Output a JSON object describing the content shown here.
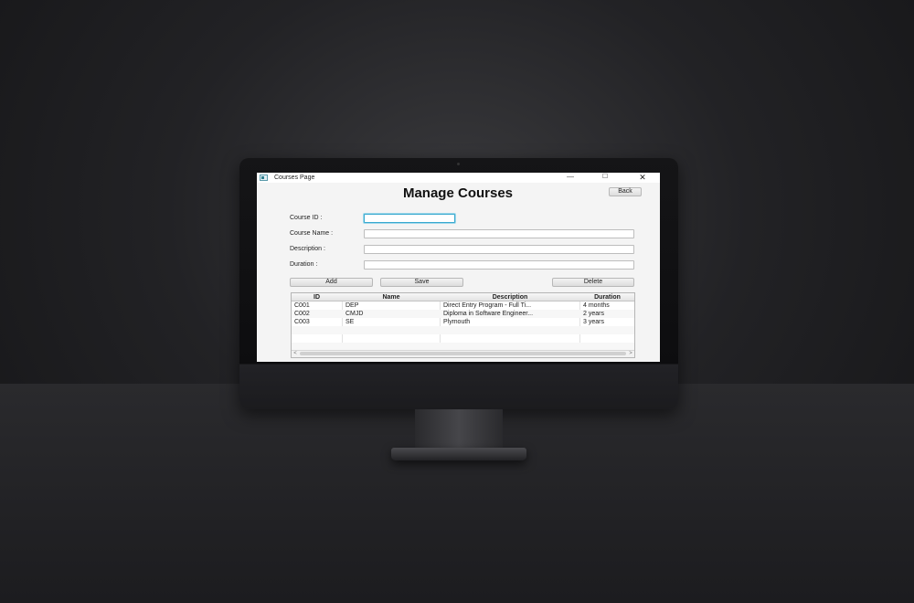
{
  "window": {
    "title": "Courses Page",
    "minimize_glyph": "—",
    "maximize_glyph": "☐",
    "close_glyph": "✕"
  },
  "page": {
    "heading": "Manage Courses",
    "back_label": "Back"
  },
  "form": {
    "course_id_label": "Course ID :",
    "course_name_label": "Course Name :",
    "description_label": "Description :",
    "duration_label": "Duration :",
    "course_id_value": "",
    "course_name_value": "",
    "description_value": "",
    "duration_value": ""
  },
  "actions": {
    "add_label": "Add",
    "save_label": "Save",
    "delete_label": "Delete"
  },
  "table": {
    "headers": {
      "id": "ID",
      "name": "Name",
      "description": "Description",
      "duration": "Duration"
    },
    "rows": [
      {
        "id": "C001",
        "name": "DEP",
        "description": "Direct Entry Program - Full Ti...",
        "duration": "4 months"
      },
      {
        "id": "C002",
        "name": "CMJD",
        "description": "Diploma in Software Engineer...",
        "duration": "2 years"
      },
      {
        "id": "C003",
        "name": "SE",
        "description": "Plymouth",
        "duration": "3 years"
      }
    ],
    "scroll_left_glyph": "<",
    "scroll_right_glyph": ">"
  },
  "colors": {
    "focus_accent": "#39a9cf",
    "window_bg": "#f4f4f4"
  }
}
